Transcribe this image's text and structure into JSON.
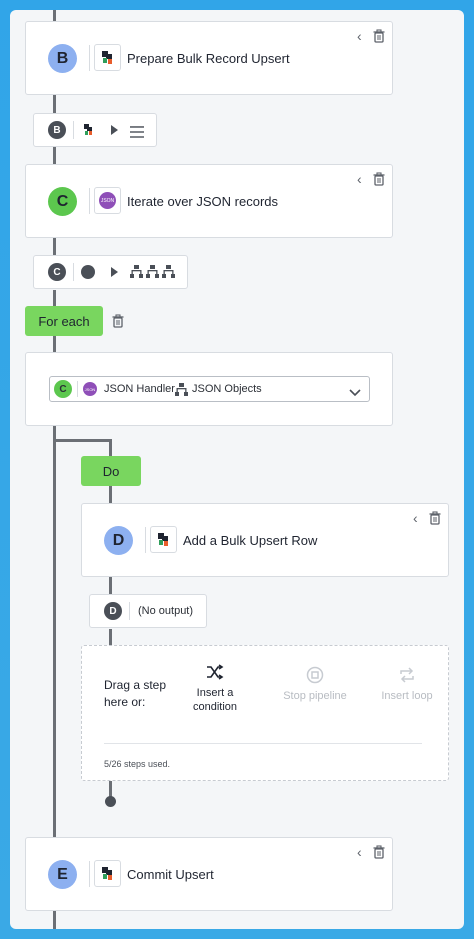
{
  "steps": [
    {
      "letter": "B",
      "title": "Prepare Bulk Record Upsert"
    },
    {
      "letter": "C",
      "title": "Iterate over JSON records",
      "app_badge": "JSON"
    },
    {
      "letter": "D",
      "title": "Add a Bulk Upsert Row"
    },
    {
      "letter": "E",
      "title": "Commit Upsert"
    }
  ],
  "outputs": [
    {
      "letter": "B"
    },
    {
      "letter": "C"
    },
    {
      "letter": "D",
      "text": "(No output)"
    }
  ],
  "loop": {
    "for_each_label": "For each",
    "do_label": "Do",
    "select": {
      "letter": "C",
      "badge": "JSON",
      "handler": "JSON Handler",
      "objects": "JSON Objects"
    }
  },
  "drop_zone": {
    "prompt": "Drag a step here or:",
    "insert_condition": "Insert a condition",
    "stop_pipeline": "Stop pipeline",
    "insert_loop": "Insert loop",
    "usage": "5/26 steps used."
  },
  "colors": {
    "background": "#33a6e7",
    "letter_blue": "#8db0f0",
    "letter_green": "#5cc74e",
    "pill_green": "#79d65f",
    "json_purple": "#8f4fb8"
  }
}
